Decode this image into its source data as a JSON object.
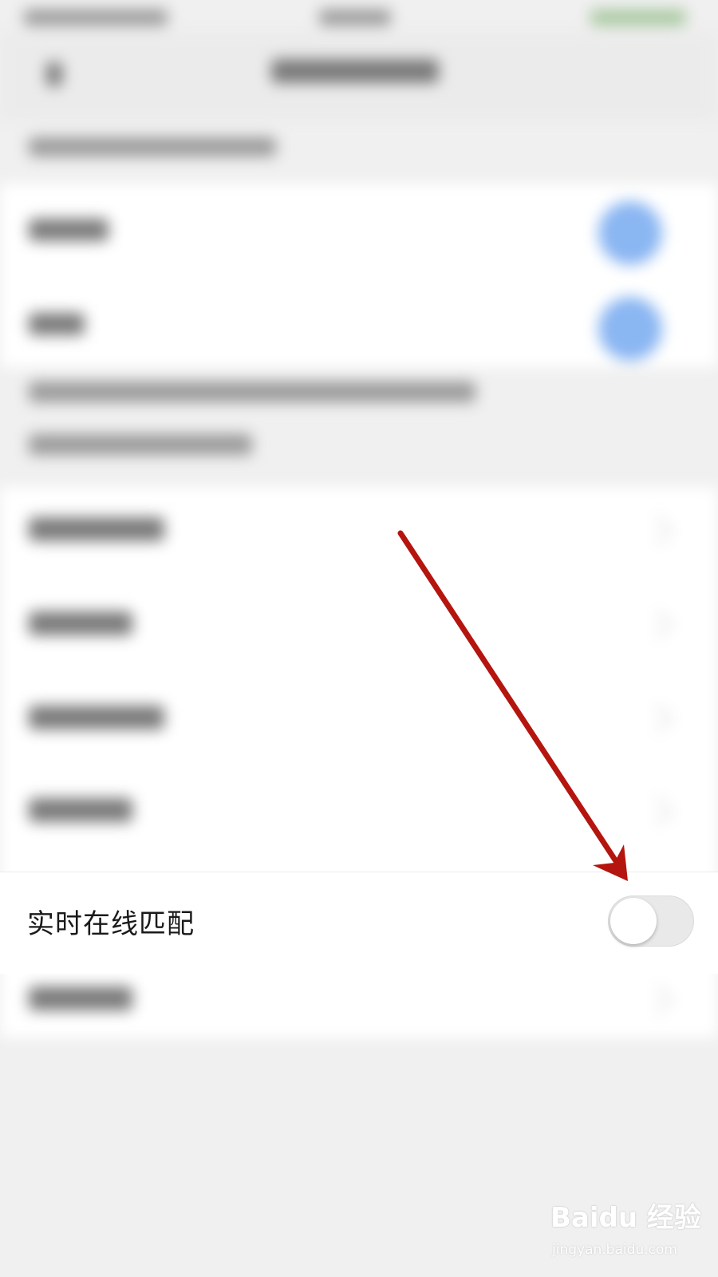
{
  "focused_setting": {
    "label": "实时在线匹配",
    "toggle_on": false
  },
  "colors": {
    "annotation_arrow": "#b5150f",
    "toggle_off_track": "#e9e9e9",
    "blurred_toggle_on": "#8ab6f2"
  },
  "watermark": {
    "logo": "Baidu 经验",
    "url": "jingyan.baidu.com"
  },
  "icons": [
    "back-arrow-icon",
    "chevron-right-icon",
    "toggle-switch",
    "annotation-arrow-icon",
    "baidu-paw-icon"
  ]
}
